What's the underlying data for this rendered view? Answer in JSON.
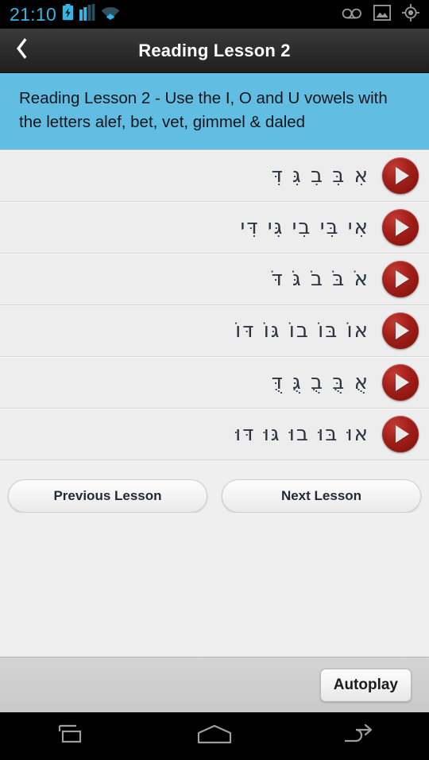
{
  "status_bar": {
    "time": "21:10",
    "left_icons": [
      "battery-charging-icon",
      "signal-bars-icon",
      "wifi-icon"
    ],
    "right_icons": [
      "voicemail-icon",
      "screenshot-image-icon",
      "gps-location-icon"
    ],
    "clock_color": "#33b5e5"
  },
  "action_bar": {
    "back_label": "‹",
    "title": "Reading Lesson 2"
  },
  "banner": {
    "text": "Reading Lesson 2 - Use the I, O and U vowels with the letters alef, bet, vet, gimmel & daled",
    "background_color": "#62bde2"
  },
  "lesson_rows": [
    {
      "text": "אִ בִּ בִ גִּ דִּ",
      "play_label": "play-row-1"
    },
    {
      "text": "אִי בִּי בִי גִּי דִּי",
      "play_label": "play-row-2"
    },
    {
      "text": "אֹ בֹּ בֹ גֹּ דֹּ",
      "play_label": "play-row-3"
    },
    {
      "text": "אוֹ בּוֹ בוֹ גּוֹ דּוֹ",
      "play_label": "play-row-4"
    },
    {
      "text": "אֻ בֻּ בֻ גֻּ דֻּ",
      "play_label": "play-row-5"
    },
    {
      "text": "אוּ בּוּ בוּ גּוּ דּוּ",
      "play_label": "play-row-6"
    }
  ],
  "navigation": {
    "previous_label": "Previous Lesson",
    "next_label": "Next Lesson"
  },
  "footer": {
    "autoplay_label": "Autoplay"
  },
  "system_nav": {
    "buttons": [
      "recents-icon",
      "home-icon",
      "back-icon"
    ]
  }
}
